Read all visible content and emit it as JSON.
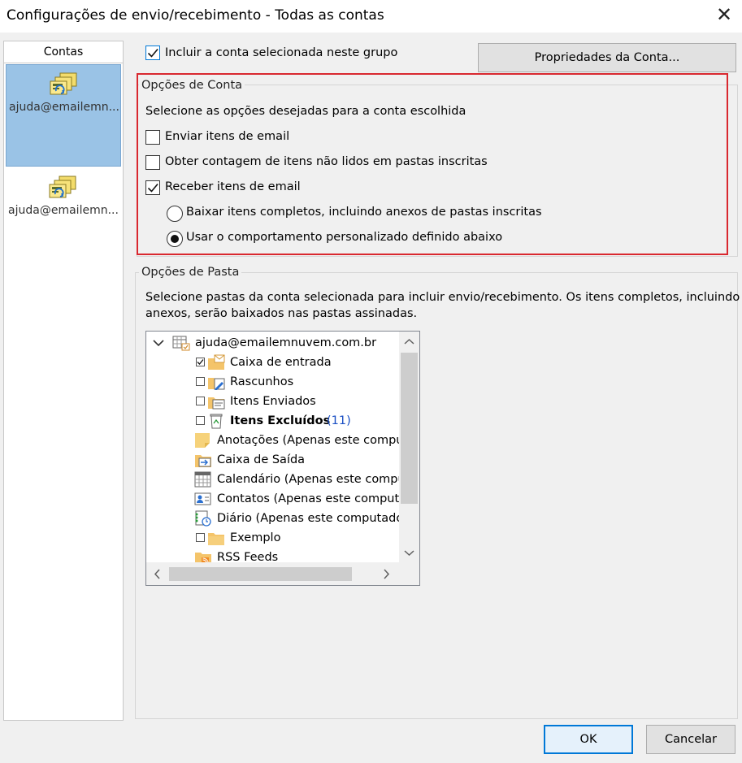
{
  "window": {
    "title": "Configurações de envio/recebimento - Todas as contas",
    "close_glyph": "✕"
  },
  "accounts": {
    "header": "Contas",
    "items": [
      {
        "label": "ajuda@emailemn...",
        "selected": true,
        "icon": "account-sendreceive-icon"
      },
      {
        "label": "ajuda@emailemn...",
        "selected": false,
        "icon": "account-sendreceive-icon"
      }
    ]
  },
  "include_account": {
    "label": "Incluir a conta selecionada neste grupo",
    "checked": true
  },
  "properties_button": "Propriedades da Conta...",
  "account_options": {
    "title": "Opções de Conta",
    "description": "Selecione as opções desejadas para a conta escolhida",
    "send_items": {
      "label": "Enviar itens de email",
      "checked": false
    },
    "unread_count": {
      "label": "Obter contagem de itens não lidos em pastas inscritas",
      "checked": false
    },
    "receive_items": {
      "label": "Receber itens de email",
      "checked": true
    },
    "download_full": {
      "label": "Baixar itens completos, incluindo anexos de pastas inscritas",
      "selected": false
    },
    "custom_behavior": {
      "label": "Usar o comportamento personalizado definido abaixo",
      "selected": true
    }
  },
  "folder_options": {
    "title": "Opções de Pasta",
    "description_line1": "Selecione pastas da conta selecionada para incluir envio/recebimento. Os itens completos, incluindo",
    "description_line2": "anexos, serão baixados nas pastas assinadas.",
    "tree": {
      "root": {
        "label": "ajuda@emailemnuvem.com.br",
        "expanded": true
      },
      "items": [
        {
          "label": "Caixa de entrada",
          "checkbox": true,
          "checked": true,
          "icon": "inbox-folder-icon"
        },
        {
          "label": "Rascunhos",
          "checkbox": true,
          "checked": false,
          "icon": "drafts-folder-icon"
        },
        {
          "label": "Itens Enviados",
          "checkbox": true,
          "checked": false,
          "icon": "sent-folder-icon"
        },
        {
          "label": "Itens Excluídos",
          "count": "(11)",
          "checkbox": true,
          "checked": false,
          "bold": true,
          "icon": "recycle-bin-icon"
        },
        {
          "label": "Anotações (Apenas este comput",
          "checkbox": false,
          "icon": "notes-icon"
        },
        {
          "label": "Caixa de Saída",
          "checkbox": false,
          "icon": "outbox-icon"
        },
        {
          "label": "Calendário (Apenas este comput",
          "checkbox": false,
          "icon": "calendar-icon"
        },
        {
          "label": "Contatos (Apenas este computad",
          "checkbox": false,
          "icon": "contacts-icon"
        },
        {
          "label": "Diário (Apenas este computador",
          "checkbox": false,
          "icon": "journal-icon"
        },
        {
          "label": "Exemplo",
          "checkbox": true,
          "checked": false,
          "icon": "folder-icon"
        },
        {
          "label": "RSS Feeds",
          "checkbox": false,
          "icon": "rss-folder-icon"
        }
      ]
    }
  },
  "buttons": {
    "ok": "OK",
    "cancel": "Cancelar"
  },
  "colors": {
    "accent": "#0078d7",
    "highlight_box": "#d9282f",
    "selected_account": "#9ac3e6",
    "count_text": "#1a4fc4"
  }
}
